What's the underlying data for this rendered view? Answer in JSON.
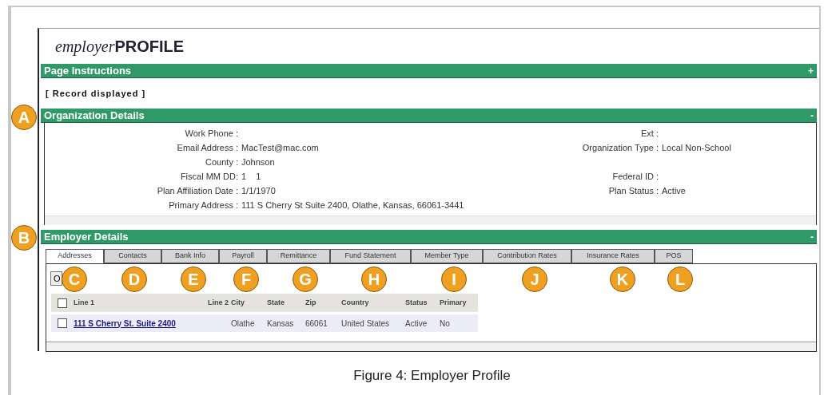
{
  "app_title": {
    "prefix": "employer",
    "main": "PROFILE"
  },
  "sections": [
    {
      "title": "Page Instructions",
      "toggle": "+"
    }
  ],
  "record_status": "[ Record displayed ]",
  "organization": {
    "title": "Organization Details",
    "toggle": "-",
    "rows": [
      {
        "left": {
          "label": "Work Phone :"
        },
        "right": {
          "label": "Ext :"
        }
      },
      {
        "left": {
          "label": "Email Address :",
          "value": "MacTest@mac.com"
        },
        "right": {
          "label": "Organization Type :",
          "value": "Local Non-School"
        }
      },
      {
        "left": {
          "label": "County :",
          "value": "Johnson"
        }
      },
      {
        "left": {
          "label": "Fiscal MM DD:",
          "value": "1    1"
        },
        "right": {
          "label": "Federal ID :"
        }
      },
      {
        "left": {
          "label": "Plan Affiliation Date :",
          "value": "1/1/1970"
        },
        "right": {
          "label": "Plan Status :",
          "value": "Active"
        }
      },
      {
        "left": {
          "label": "Primary Address :",
          "value": "111 S Cherry St Suite 2400, Olathe, Kansas, 66061-3441"
        }
      }
    ]
  },
  "employer": {
    "title": "Employer Details",
    "toggle": "-",
    "tabs": [
      {
        "label": "Addresses",
        "selected": true
      },
      {
        "label": "Contacts",
        "selected": false
      },
      {
        "label": "Bank Info",
        "selected": false
      },
      {
        "label": "Payroll",
        "selected": false
      },
      {
        "label": "Remittance",
        "selected": false
      },
      {
        "label": "Fund Statement",
        "selected": false
      },
      {
        "label": "Member Type",
        "selected": false
      },
      {
        "label": "Contribution Rates",
        "selected": false
      },
      {
        "label": "Insurance Rates",
        "selected": false
      },
      {
        "label": "POS",
        "selected": false
      }
    ],
    "button": "O",
    "table": {
      "select_all": {
        "checked": false
      },
      "columns": [
        "Line 1",
        "Line 2",
        "City",
        "State",
        "Zip",
        "Country",
        "Status",
        "Primary"
      ],
      "rows": [
        {
          "checked": false,
          "cells": [
            "111 S Cherry St. Suite 2400",
            null,
            "Olathe",
            "Kansas",
            "66061",
            "United States",
            "Active",
            "No"
          ]
        }
      ]
    }
  },
  "callouts": [
    {
      "label": "A"
    },
    {
      "label": "B"
    },
    {
      "label": "C"
    },
    {
      "label": "D"
    },
    {
      "label": "E"
    },
    {
      "label": "F"
    },
    {
      "label": "G"
    },
    {
      "label": "H"
    },
    {
      "label": "I"
    },
    {
      "label": "J"
    },
    {
      "label": "K"
    },
    {
      "label": "L"
    }
  ],
  "caption": "Figure 4: Employer Profile"
}
